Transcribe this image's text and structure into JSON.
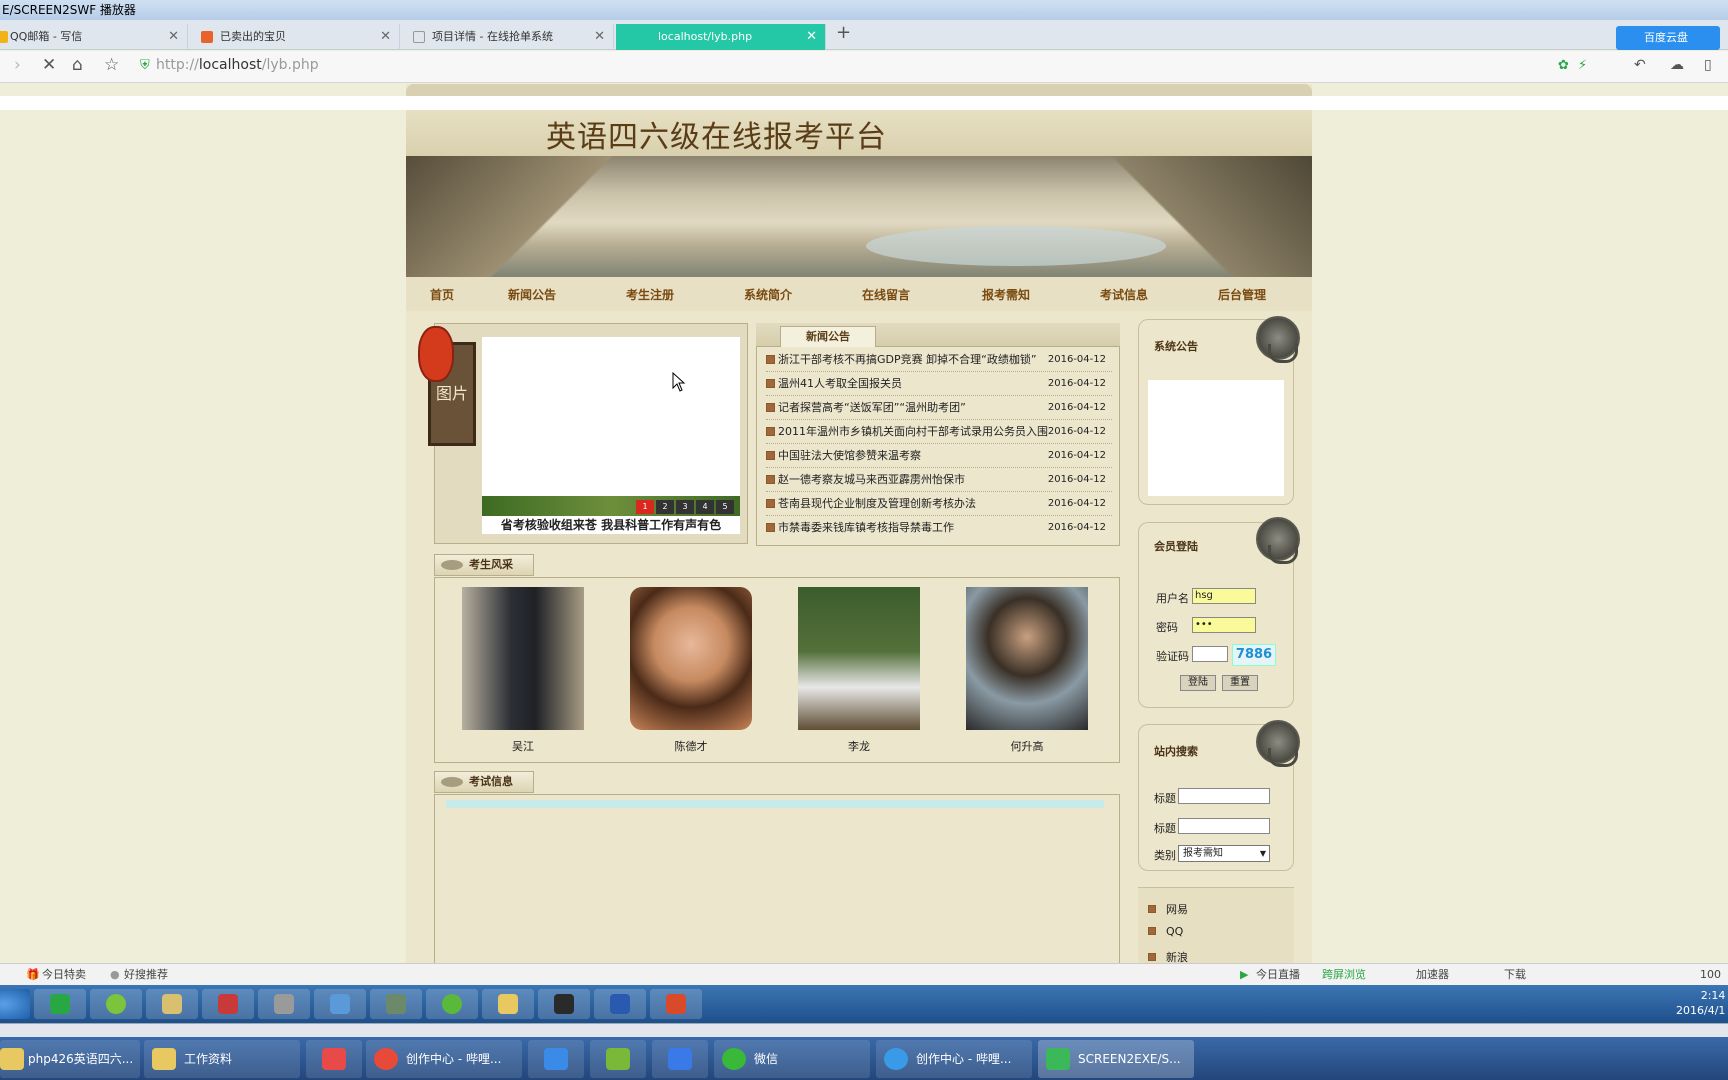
{
  "window": {
    "title": "E/SCREEN2SWF 播放器"
  },
  "tabs": [
    {
      "label": "QQ邮箱 - 写信",
      "color": "#f2b318"
    },
    {
      "label": "已卖出的宝贝",
      "color": "#e9622b"
    },
    {
      "label": "项目详情 - 在线抢单系统",
      "color": "#999999"
    },
    {
      "label": "localhost/lyb.php",
      "color": "#25c8a6"
    }
  ],
  "cloud_button": "百度云盘",
  "address": {
    "scheme": "http://",
    "host": "localhost",
    "path": "/lyb.php"
  },
  "site": {
    "title": "英语四六级在线报考平台",
    "menu": [
      "首页",
      "新闻公告",
      "考生注册",
      "系统简介",
      "在线留言",
      "报考需知",
      "考试信息",
      "后台管理"
    ],
    "pic_tag": "图片",
    "slide_caption": "省考核验收组来苍 我县科普工作有声有色",
    "slide_dots": [
      "1",
      "2",
      "3",
      "4",
      "5"
    ],
    "news_title": "新闻公告",
    "news": [
      {
        "title": "浙江干部考核不再搞GDP竞赛 卸掉不合理“政绩枷锁”",
        "date": "2016-04-12"
      },
      {
        "title": "温州41人考取全国报关员",
        "date": "2016-04-12"
      },
      {
        "title": "记者探营高考“送饭军团”“温州助考团”",
        "date": "2016-04-12"
      },
      {
        "title": "2011年温州市乡镇机关面向村干部考试录用公务员入围",
        "date": "2016-04-12"
      },
      {
        "title": "中国驻法大使馆参赞来温考察",
        "date": "2016-04-12"
      },
      {
        "title": "赵一德考察友城马来西亚霹雳州怡保市",
        "date": "2016-04-12"
      },
      {
        "title": "苍南县现代企业制度及管理创新考核办法",
        "date": "2016-04-12"
      },
      {
        "title": "市禁毒委来钱库镇考核指导禁毒工作",
        "date": "2016-04-12"
      }
    ],
    "students_title": "考生风采",
    "students": [
      "吴江",
      "陈德才",
      "李龙",
      "何升高"
    ],
    "exam_title": "考试信息",
    "right": {
      "notice_title": "系统公告",
      "login_title": "会员登陆",
      "username_label": "用户名",
      "username_value": "hsg",
      "password_label": "密码",
      "password_value": "•••",
      "captcha_label": "验证码",
      "captcha_value": "7886",
      "login_btn": "登陆",
      "reset_btn": "重置",
      "search_title": "站内搜索",
      "search_label1": "标题",
      "search_label2": "标题",
      "category_label": "类别",
      "category_value": "报考需知",
      "links": [
        "网易",
        "QQ",
        "新浪"
      ]
    }
  },
  "statusbar": {
    "left1": "今日特卖",
    "left2": "好搜推荐",
    "r1": "今日直播",
    "r2": "跨屏浏览",
    "r3": "加速器",
    "r4": "下载",
    "zoom": "100"
  },
  "taskbar": {
    "clock_time": "2:14",
    "clock_date": "2016/4/1",
    "items": [
      "php426英语四六...",
      "工作资料",
      "",
      "创作中心 - 哔哩...",
      "",
      "",
      "",
      "微信",
      "创作中心 - 哔哩...",
      "SCREEN2EXE/S..."
    ]
  }
}
